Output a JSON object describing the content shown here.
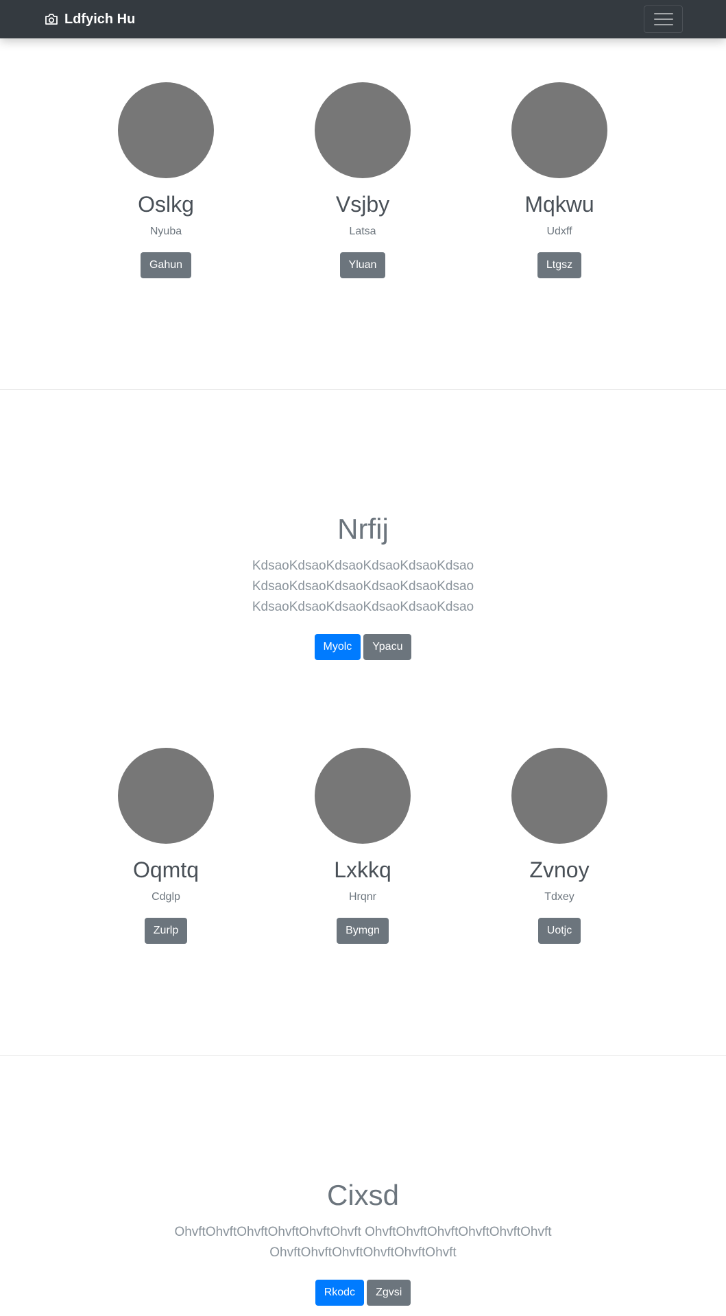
{
  "navbar": {
    "brand": "Ldfyich Hu",
    "brand_icon": "camera-icon",
    "toggler_icon": "hamburger-icon"
  },
  "team_1": [
    {
      "name": "Oslkg",
      "role": "Nyuba",
      "button": "Gahun"
    },
    {
      "name": "Vsjby",
      "role": "Latsa",
      "button": "Yluan"
    },
    {
      "name": "Mqkwu",
      "role": "Udxff",
      "button": "Ltgsz"
    }
  ],
  "hero_1": {
    "title": "Nrfij",
    "text": "KdsaoKdsaoKdsaoKdsaoKdsaoKdsao KdsaoKdsaoKdsaoKdsaoKdsaoKdsao KdsaoKdsaoKdsaoKdsaoKdsaoKdsao",
    "primary_button": "Myolc",
    "secondary_button": "Ypacu"
  },
  "team_2": [
    {
      "name": "Oqmtq",
      "role": "Cdglp",
      "button": "Zurlp"
    },
    {
      "name": "Lxkkq",
      "role": "Hrqnr",
      "button": "Bymgn"
    },
    {
      "name": "Zvnoy",
      "role": "Tdxey",
      "button": "Uotjc"
    }
  ],
  "hero_2": {
    "title": "Cixsd",
    "text": "OhvftOhvftOhvftOhvftOhvftOhvft OhvftOhvftOhvftOhvftOhvftOhvft OhvftOhvftOhvftOhvftOhvftOhvft",
    "primary_button": "Rkodc",
    "secondary_button": "Zgvsi"
  },
  "colors": {
    "navbar": "#343a40",
    "avatar": "#777777",
    "primary": "#007bff",
    "secondary": "#6c757d"
  }
}
